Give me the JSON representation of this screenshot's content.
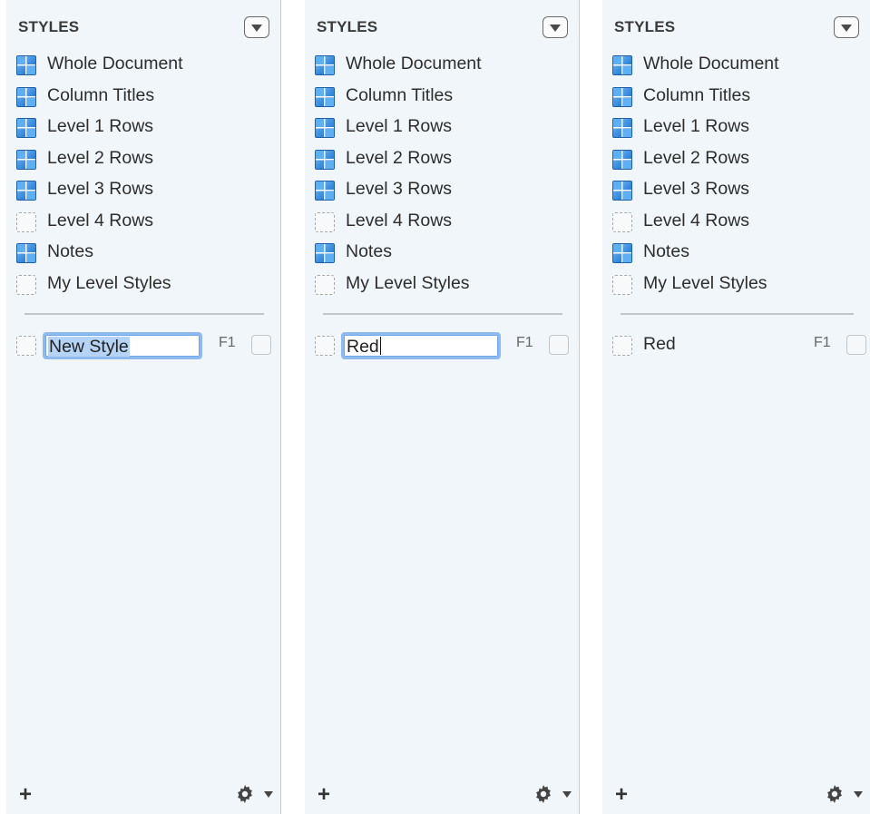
{
  "panels": [
    {
      "title": "STYLES",
      "items": [
        {
          "label": "Whole Document",
          "icon": "filled"
        },
        {
          "label": "Column Titles",
          "icon": "filled"
        },
        {
          "label": "Level 1 Rows",
          "icon": "filled"
        },
        {
          "label": "Level 2 Rows",
          "icon": "filled"
        },
        {
          "label": "Level 3 Rows",
          "icon": "filled"
        },
        {
          "label": "Level 4 Rows",
          "icon": "empty"
        },
        {
          "label": "Notes",
          "icon": "filled"
        },
        {
          "label": "My Level Styles",
          "icon": "empty"
        }
      ],
      "new_style": {
        "value": "New Style",
        "key": "F1",
        "state": "editing-selected"
      },
      "footer": {
        "add_label": "+"
      }
    },
    {
      "title": "STYLES",
      "items": [
        {
          "label": "Whole Document",
          "icon": "filled"
        },
        {
          "label": "Column Titles",
          "icon": "filled"
        },
        {
          "label": "Level 1 Rows",
          "icon": "filled"
        },
        {
          "label": "Level 2 Rows",
          "icon": "filled"
        },
        {
          "label": "Level 3 Rows",
          "icon": "filled"
        },
        {
          "label": "Level 4 Rows",
          "icon": "empty"
        },
        {
          "label": "Notes",
          "icon": "filled"
        },
        {
          "label": "My Level Styles",
          "icon": "empty"
        }
      ],
      "new_style": {
        "value": "Red",
        "key": "F1",
        "state": "editing-caret"
      },
      "footer": {
        "add_label": "+"
      }
    },
    {
      "title": "STYLES",
      "items": [
        {
          "label": "Whole Document",
          "icon": "filled"
        },
        {
          "label": "Column Titles",
          "icon": "filled"
        },
        {
          "label": "Level 1 Rows",
          "icon": "filled"
        },
        {
          "label": "Level 2 Rows",
          "icon": "filled"
        },
        {
          "label": "Level 3 Rows",
          "icon": "filled"
        },
        {
          "label": "Level 4 Rows",
          "icon": "empty"
        },
        {
          "label": "Notes",
          "icon": "filled"
        },
        {
          "label": "My Level Styles",
          "icon": "empty"
        }
      ],
      "new_style": {
        "value": "Red",
        "key": "F1",
        "state": "static"
      },
      "footer": {
        "add_label": "+"
      }
    }
  ],
  "icons": {
    "style_filled": "blue-quad-style-icon",
    "style_empty": "dashed-empty-style-icon",
    "menu": "dropdown-triangle-icon",
    "gear": "gear-icon",
    "add": "plus-icon"
  },
  "colors": {
    "panel_bg": "#f0f6fa",
    "accent_blue": "#3b8de0",
    "focus_ring": "#8fbaf0",
    "selection": "#b5d3f6"
  }
}
